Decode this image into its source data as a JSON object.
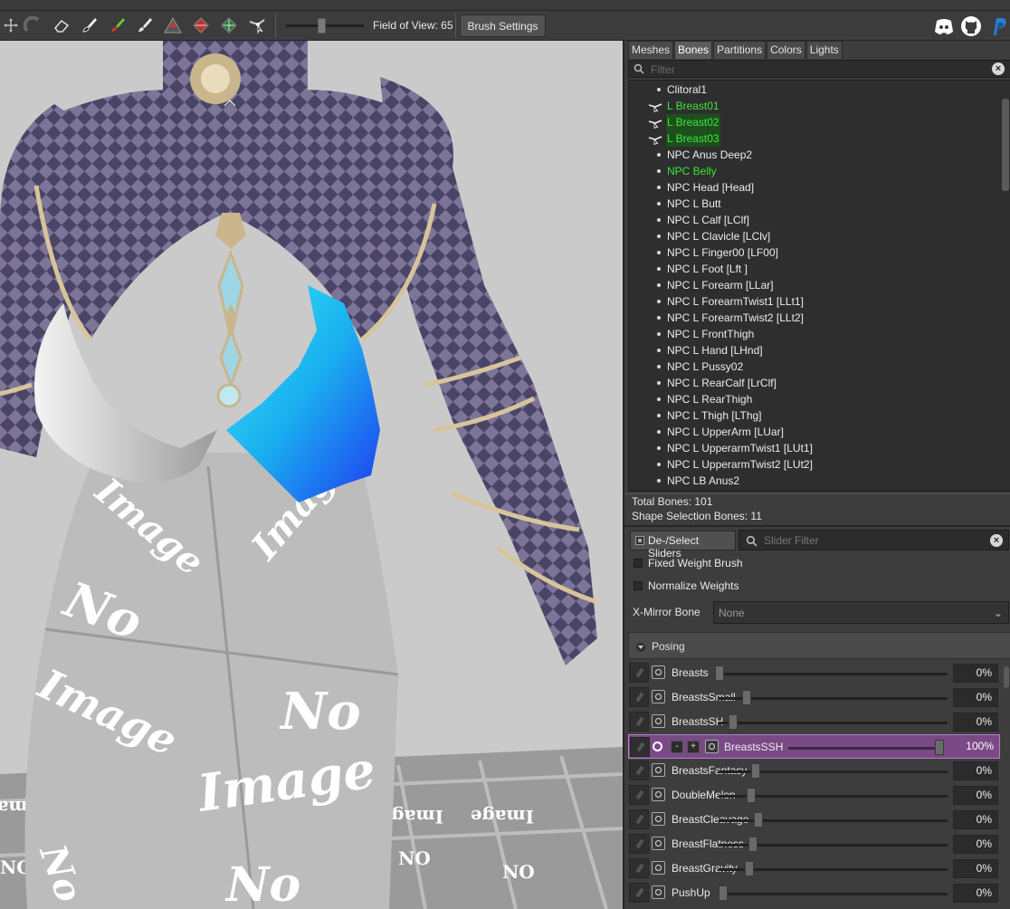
{
  "toolbar": {
    "tools": [
      {
        "icon": "move-icon"
      },
      {
        "icon": "select-icon"
      },
      {
        "icon": "eraser-icon"
      },
      {
        "icon": "mask-brush-icon"
      },
      {
        "icon": "color-brush-icon"
      },
      {
        "icon": "alpha-brush-icon"
      },
      {
        "icon": "inflate-icon"
      },
      {
        "icon": "deflate-icon"
      },
      {
        "icon": "move-vertex-icon"
      },
      {
        "icon": "weight-brush-icon"
      }
    ],
    "fov_label": "Field of View: 65",
    "fov_value": 65,
    "brush_settings_label": "Brush Settings",
    "social": [
      "discord-icon",
      "github-icon",
      "paypal-icon"
    ]
  },
  "tabs": {
    "meshes": "Meshes",
    "bones": "Bones",
    "partitions": "Partitions",
    "colors": "Colors",
    "lights": "Lights",
    "active": "Bones"
  },
  "bone_filter": {
    "placeholder": "Filter"
  },
  "bones": [
    {
      "label": "Clitoral1",
      "color": "normal",
      "weighted": false
    },
    {
      "label": "L Breast01",
      "color": "green",
      "weighted": true
    },
    {
      "label": "L Breast02",
      "color": "green-highlight",
      "weighted": true
    },
    {
      "label": "L Breast03",
      "color": "green-highlight",
      "weighted": true
    },
    {
      "label": "NPC Anus Deep2",
      "color": "normal",
      "weighted": false
    },
    {
      "label": "NPC Belly",
      "color": "green",
      "weighted": false
    },
    {
      "label": "NPC Head [Head]",
      "color": "normal",
      "weighted": false
    },
    {
      "label": "NPC L Butt",
      "color": "normal",
      "weighted": false
    },
    {
      "label": "NPC L Calf [LClf]",
      "color": "normal",
      "weighted": false
    },
    {
      "label": "NPC L Clavicle [LClv]",
      "color": "normal",
      "weighted": false
    },
    {
      "label": "NPC L Finger00 [LF00]",
      "color": "normal",
      "weighted": false
    },
    {
      "label": "NPC L Foot [Lft ]",
      "color": "normal",
      "weighted": false
    },
    {
      "label": "NPC L Forearm [LLar]",
      "color": "normal",
      "weighted": false
    },
    {
      "label": "NPC L ForearmTwist1 [LLt1]",
      "color": "normal",
      "weighted": false
    },
    {
      "label": "NPC L ForearmTwist2 [LLt2]",
      "color": "normal",
      "weighted": false
    },
    {
      "label": "NPC L FrontThigh",
      "color": "normal",
      "weighted": false
    },
    {
      "label": "NPC L Hand [LHnd]",
      "color": "normal",
      "weighted": false
    },
    {
      "label": "NPC L Pussy02",
      "color": "normal",
      "weighted": false
    },
    {
      "label": "NPC L RearCalf [LrClf]",
      "color": "normal",
      "weighted": false
    },
    {
      "label": "NPC L RearThigh",
      "color": "normal",
      "weighted": false
    },
    {
      "label": "NPC L Thigh [LThg]",
      "color": "normal",
      "weighted": false
    },
    {
      "label": "NPC L UpperArm [LUar]",
      "color": "normal",
      "weighted": false
    },
    {
      "label": "NPC L UpperarmTwist1 [LUt1]",
      "color": "normal",
      "weighted": false
    },
    {
      "label": "NPC L UpperarmTwist2 [LUt2]",
      "color": "normal",
      "weighted": false
    },
    {
      "label": "NPC LB Anus2",
      "color": "normal",
      "weighted": false
    }
  ],
  "stats": {
    "total_bones": "Total Bones: 101",
    "shape_selection_bones": "Shape Selection Bones: 11"
  },
  "slider_controls": {
    "deselect_label": "De-/Select Sliders",
    "slider_filter_placeholder": "Slider Filter",
    "fixed_weight_brush": {
      "label": "Fixed Weight Brush",
      "checked": false
    },
    "normalize_weights": {
      "label": "Normalize Weights",
      "checked": false
    },
    "xmirror_label": "X-Mirror Bone",
    "xmirror_value": "None",
    "posing_label": "Posing"
  },
  "sliders": [
    {
      "name": "Breasts",
      "value": 0,
      "pct": "0%",
      "active": false
    },
    {
      "name": "BreastsSmall",
      "value": 0,
      "pct": "0%",
      "active": false
    },
    {
      "name": "BreastsSH",
      "value": 0,
      "pct": "0%",
      "active": false
    },
    {
      "name": "BreastsSSH",
      "value": 100,
      "pct": "100%",
      "active": true
    },
    {
      "name": "BreastsFantasy",
      "value": 0,
      "pct": "0%",
      "active": false
    },
    {
      "name": "DoubleMelon",
      "value": 0,
      "pct": "0%",
      "active": false
    },
    {
      "name": "BreastCleavage",
      "value": 0,
      "pct": "0%",
      "active": false
    },
    {
      "name": "BreastFlatness",
      "value": 0,
      "pct": "0%",
      "active": false
    },
    {
      "name": "BreastGravity",
      "value": 0,
      "pct": "0%",
      "active": false
    },
    {
      "name": "PushUp",
      "value": 0,
      "pct": "0%",
      "active": false
    }
  ],
  "viewport": {
    "texture_text": [
      "No",
      "Image"
    ],
    "background_color": "#cacaca",
    "mask_color": "#1ec8f0"
  },
  "colors": {
    "accent_green": "#3be63b",
    "active_slider": "#7a4a86",
    "panel_bg": "#3d3d3d"
  }
}
